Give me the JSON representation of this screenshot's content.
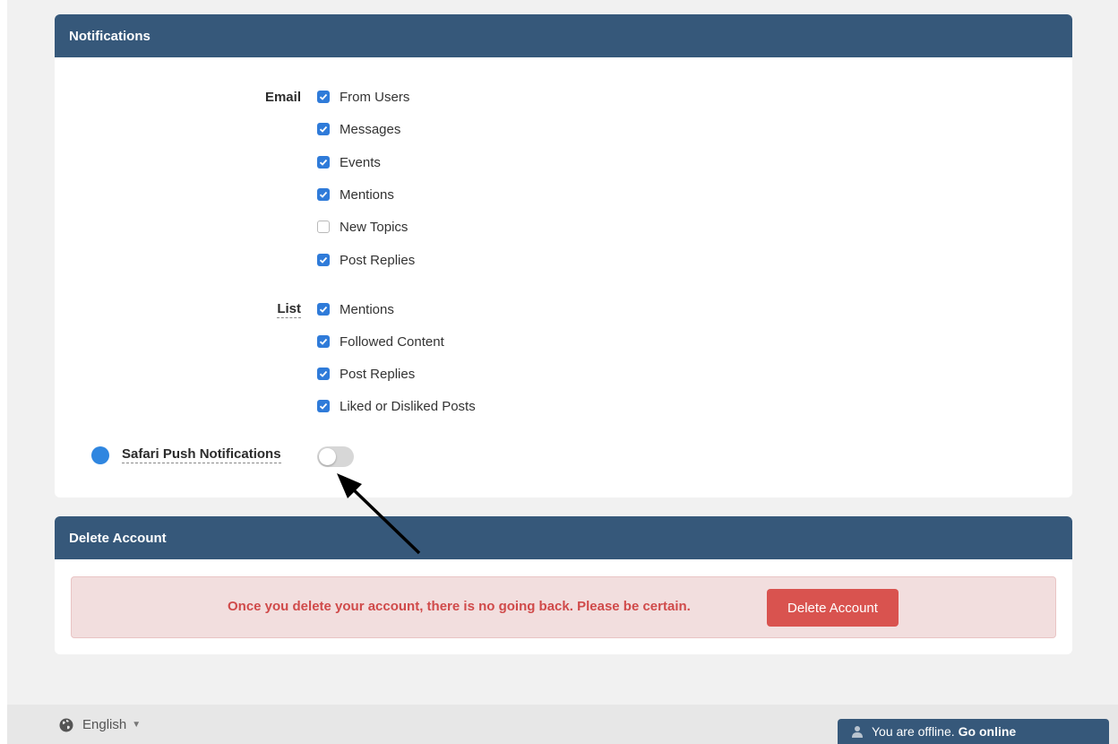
{
  "notifications": {
    "title": "Notifications",
    "email": {
      "label": "Email",
      "items": [
        {
          "label": "From Users",
          "checked": true
        },
        {
          "label": "Messages",
          "checked": true
        },
        {
          "label": "Events",
          "checked": true
        },
        {
          "label": "Mentions",
          "checked": true
        },
        {
          "label": "New Topics",
          "checked": false
        },
        {
          "label": "Post Replies",
          "checked": true
        }
      ]
    },
    "list": {
      "label": "List",
      "items": [
        {
          "label": "Mentions",
          "checked": true
        },
        {
          "label": "Followed Content",
          "checked": true
        },
        {
          "label": "Post Replies",
          "checked": true
        },
        {
          "label": "Liked or Disliked Posts",
          "checked": true
        }
      ]
    },
    "safari": {
      "label": "Safari Push Notifications",
      "enabled": false
    }
  },
  "delete_account": {
    "title": "Delete Account",
    "warning": "Once you delete your account, there is no going back. Please be certain.",
    "button_label": "Delete Account"
  },
  "footer": {
    "language": "English"
  },
  "chat_bar": {
    "status_text": "You are offline.",
    "action_text": "Go online"
  },
  "colors": {
    "header": "#36587a",
    "checkbox": "#2f7bd9",
    "danger": "#d9534f",
    "warning_bg": "#f2dede"
  }
}
